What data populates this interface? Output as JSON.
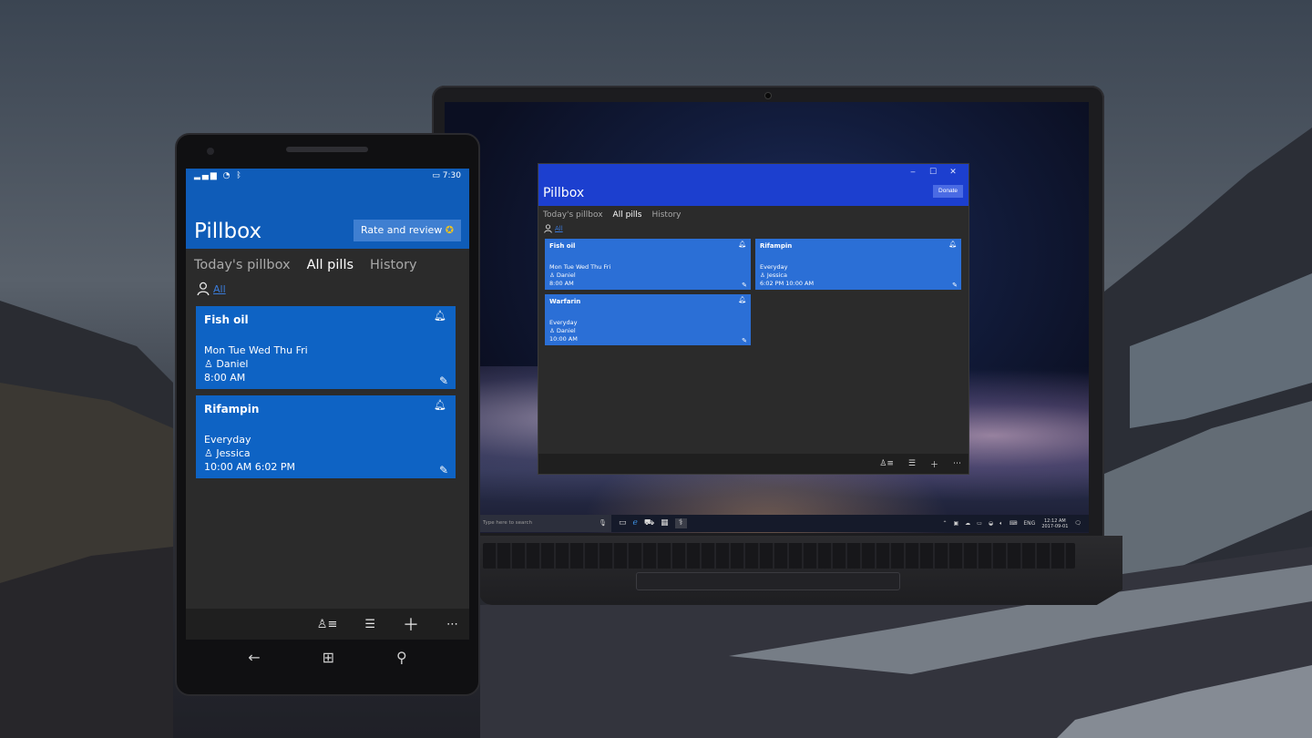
{
  "desktop_app": {
    "window_controls": [
      "‒",
      "☐",
      "✕"
    ],
    "title": "Pillbox",
    "donate_label": "Donate",
    "tabs": [
      {
        "label": "Today's pillbox"
      },
      {
        "label": "All pills"
      },
      {
        "label": "History"
      }
    ],
    "active_tab": "All pills",
    "filter_label": "All",
    "cards": [
      {
        "name": "Fish oil",
        "schedule": "Mon Tue Wed Thu Fri",
        "person": "Daniel",
        "times": "8:00 AM"
      },
      {
        "name": "Rifampin",
        "schedule": "Everyday",
        "person": "Jessica",
        "times": "6:02 PM 10:00 AM"
      },
      {
        "name": "Warfarin",
        "schedule": "Everyday",
        "person": "Daniel",
        "times": "10:00 AM"
      }
    ]
  },
  "taskbar": {
    "search_placeholder": "Type here to search",
    "language": "ENG",
    "time": "12:12 AM",
    "date": "2017-09-01"
  },
  "phone_app": {
    "status_time": "7:30",
    "title": "Pillbox",
    "rate_label": "Rate and review",
    "tabs": [
      {
        "label": "Today's pillbox"
      },
      {
        "label": "All pills"
      },
      {
        "label": "History"
      }
    ],
    "active_tab": "All pills",
    "filter_label": "All",
    "cards": [
      {
        "name": "Fish oil",
        "schedule": "Mon Tue Wed Thu Fri",
        "person": "Daniel",
        "times": "8:00 AM"
      },
      {
        "name": "Rifampin",
        "schedule": "Everyday",
        "person": "Jessica",
        "times": "10:00 AM 6:02 PM"
      }
    ]
  },
  "colors": {
    "desktop_accent": "#1c3fcf",
    "desktop_card": "#2b6fd6",
    "phone_accent": "#0f5cb8",
    "phone_card": "#0e63c4",
    "app_background": "#2b2b2b",
    "link": "#3a78d8"
  },
  "icons": {
    "person": "person-icon",
    "bell": "bell-icon",
    "edit": "pencil-icon",
    "star": "star-icon"
  }
}
